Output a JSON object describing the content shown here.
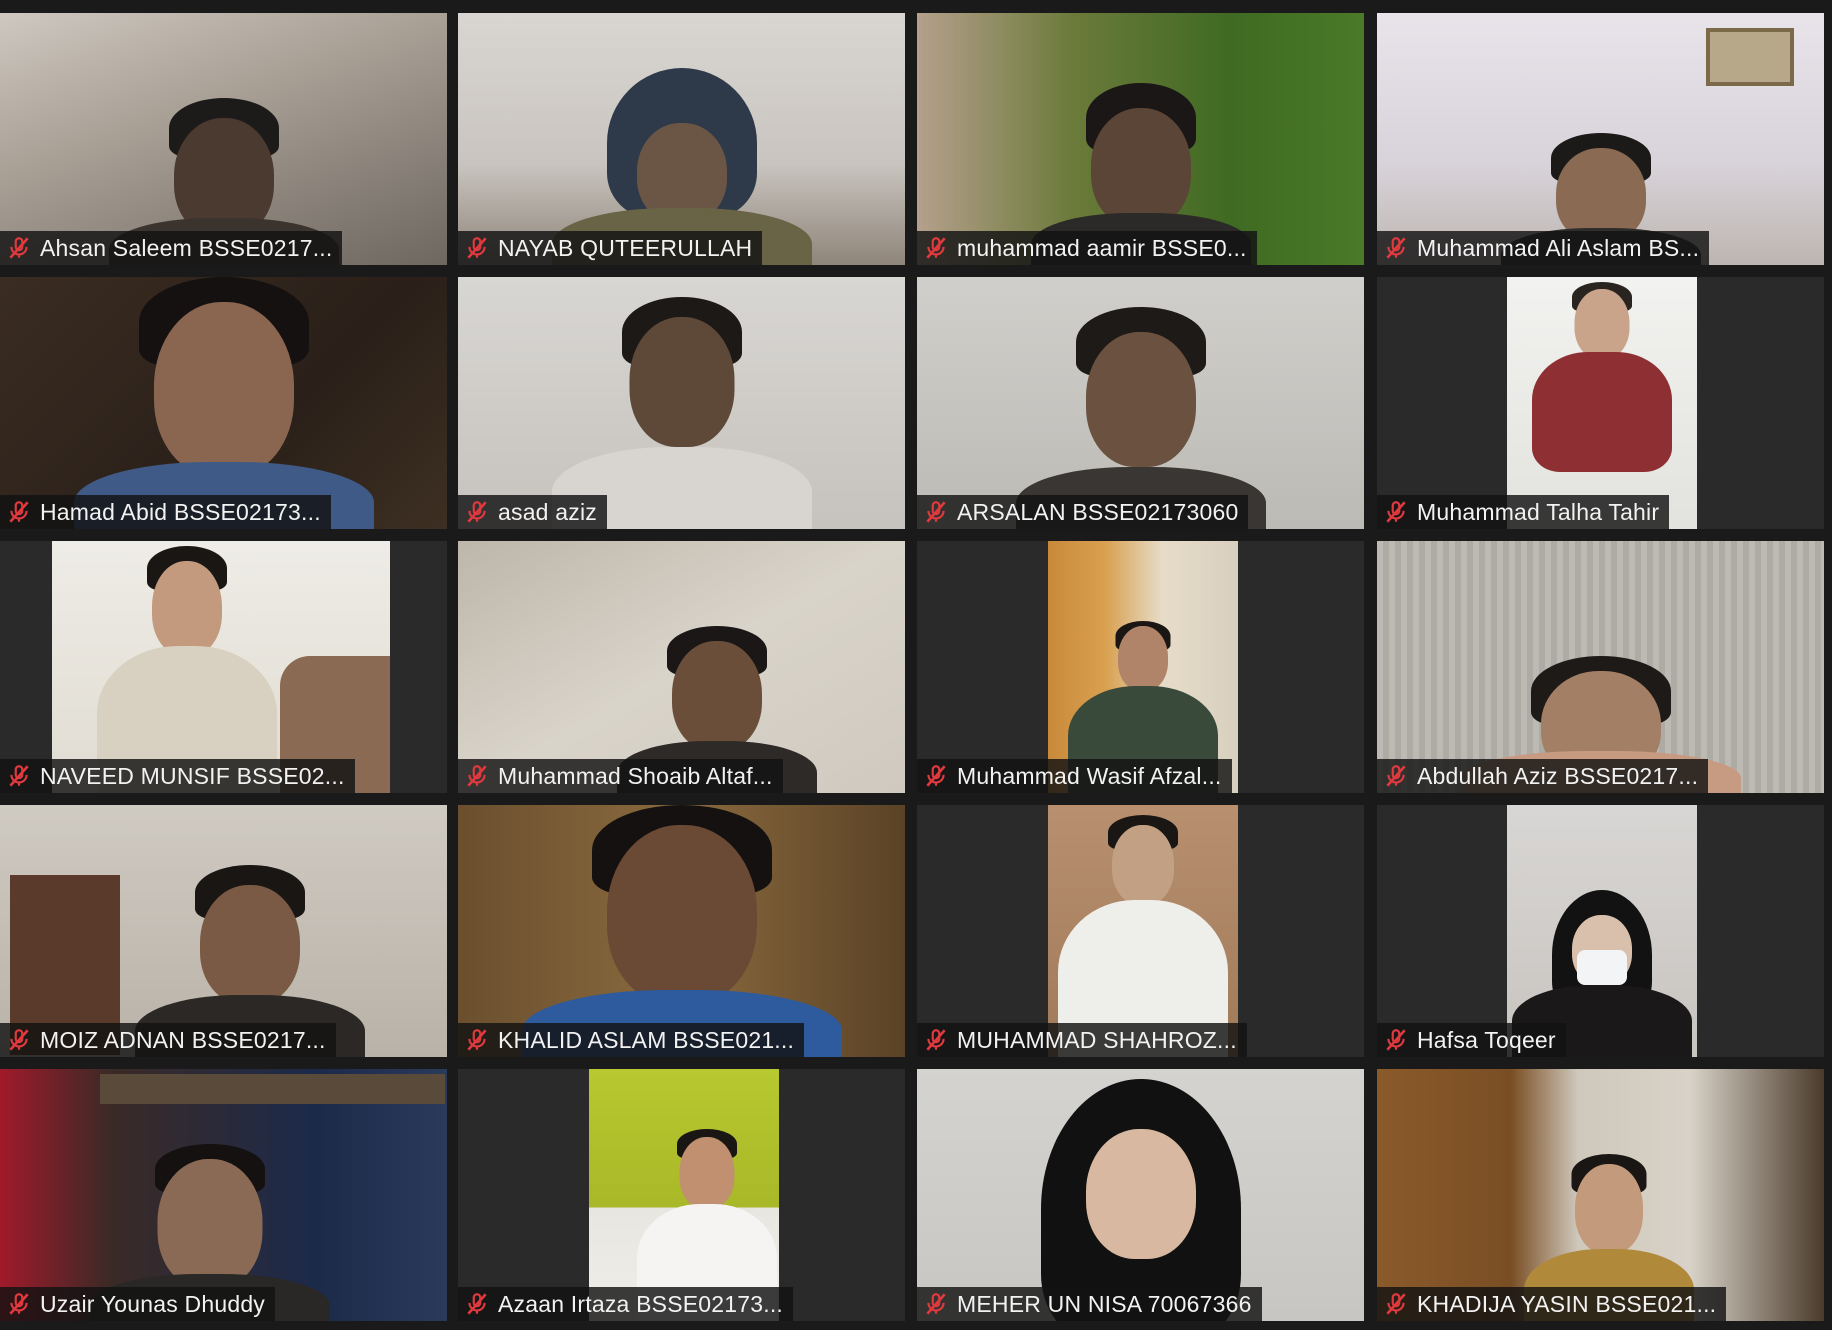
{
  "participants": [
    {
      "name": "Ahsan Saleem BSSE0217...",
      "muted": true
    },
    {
      "name": "NAYAB QUTEERULLAH",
      "muted": true
    },
    {
      "name": "muhammad aamir BSSE0...",
      "muted": true
    },
    {
      "name": "Muhammad Ali Aslam BS...",
      "muted": true
    },
    {
      "name": "Hamad Abid BSSE02173...",
      "muted": true
    },
    {
      "name": "asad aziz",
      "muted": true
    },
    {
      "name": "ARSALAN BSSE02173060",
      "muted": true
    },
    {
      "name": "Muhammad Talha Tahir",
      "muted": true
    },
    {
      "name": "NAVEED MUNSIF BSSE02...",
      "muted": true
    },
    {
      "name": "Muhammad Shoaib Altaf...",
      "muted": true
    },
    {
      "name": "Muhammad Wasif Afzal...",
      "muted": true
    },
    {
      "name": "Abdullah Aziz BSSE0217...",
      "muted": true
    },
    {
      "name": "MOIZ ADNAN BSSE0217...",
      "muted": true
    },
    {
      "name": "KHALID ASLAM BSSE021...",
      "muted": true
    },
    {
      "name": "MUHAMMAD SHAHROZ...",
      "muted": true
    },
    {
      "name": "Hafsa Toqeer",
      "muted": true
    },
    {
      "name": "Uzair Younas Dhuddy",
      "muted": true
    },
    {
      "name": "Azaan Irtaza BSSE02173...",
      "muted": true
    },
    {
      "name": "MEHER UN NISA 70067366",
      "muted": true
    },
    {
      "name": "KHADIJA YASIN BSSE021...",
      "muted": true
    }
  ],
  "colors": {
    "background": "#1a1a1a",
    "nameplate": "#121212",
    "muted_icon": "#e0393e",
    "name_text": "#f2f2f2"
  },
  "icons": {
    "muted": "microphone-muted-icon"
  }
}
